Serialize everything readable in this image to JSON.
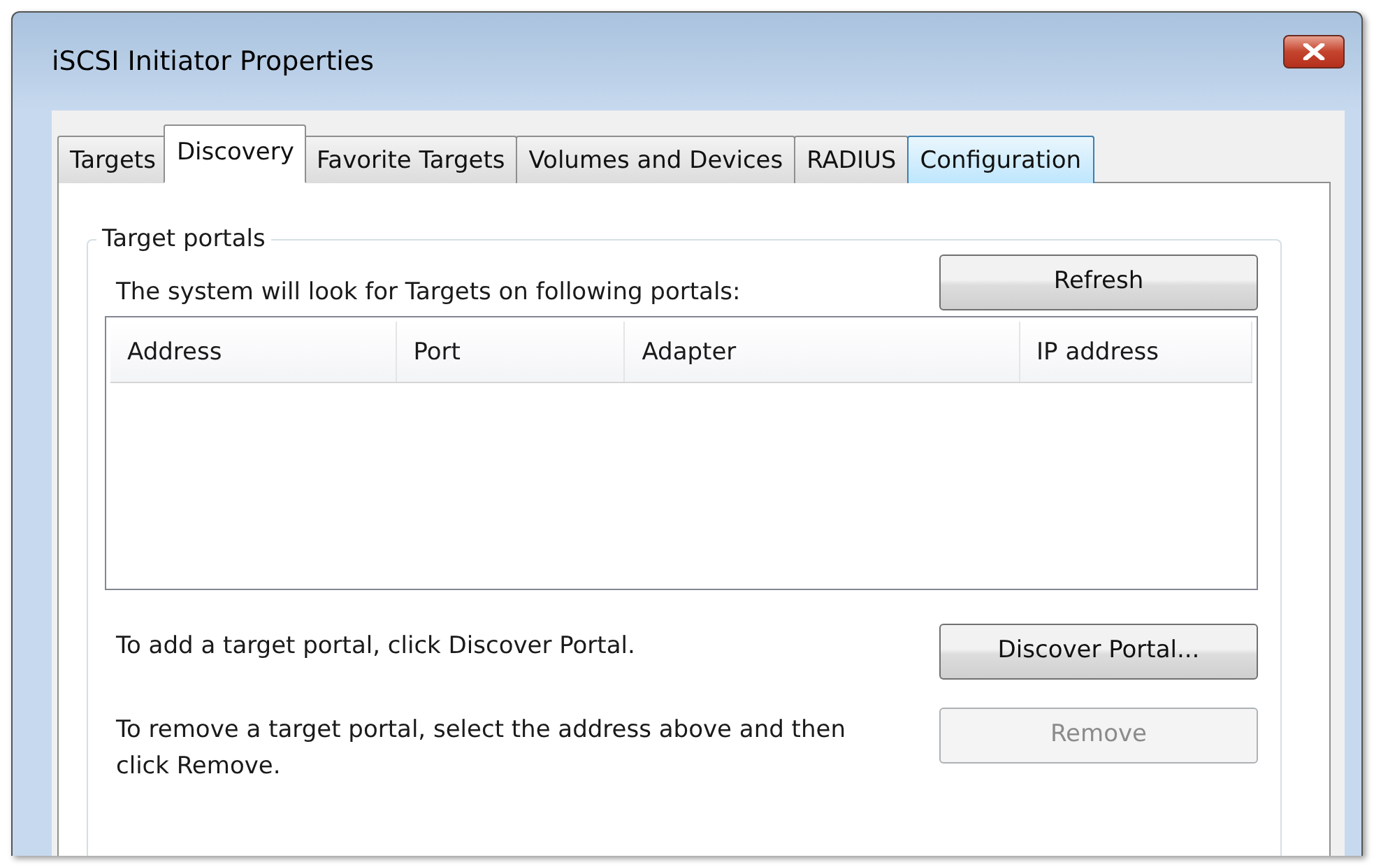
{
  "window": {
    "title": "iSCSI Initiator Properties"
  },
  "tabs": [
    {
      "label": "Targets",
      "selected": false,
      "hovered": false
    },
    {
      "label": "Discovery",
      "selected": true,
      "hovered": false
    },
    {
      "label": "Favorite Targets",
      "selected": false,
      "hovered": false
    },
    {
      "label": "Volumes and Devices",
      "selected": false,
      "hovered": false
    },
    {
      "label": "RADIUS",
      "selected": false,
      "hovered": false
    },
    {
      "label": "Configuration",
      "selected": false,
      "hovered": true
    }
  ],
  "group": {
    "title": "Target portals",
    "description": "The system will look for Targets on following portals:",
    "refresh_button": {
      "label": "Refresh",
      "disabled": false
    },
    "table": {
      "columns": [
        "Address",
        "Port",
        "Adapter",
        "IP address"
      ]
    },
    "actions": [
      {
        "text": "To add a target portal, click Discover Portal.",
        "button": {
          "label": "Discover Portal...",
          "disabled": false
        }
      },
      {
        "text": "To remove a target portal, select the address above and then click Remove.",
        "button": {
          "label": "Remove",
          "disabled": true
        }
      }
    ]
  }
}
